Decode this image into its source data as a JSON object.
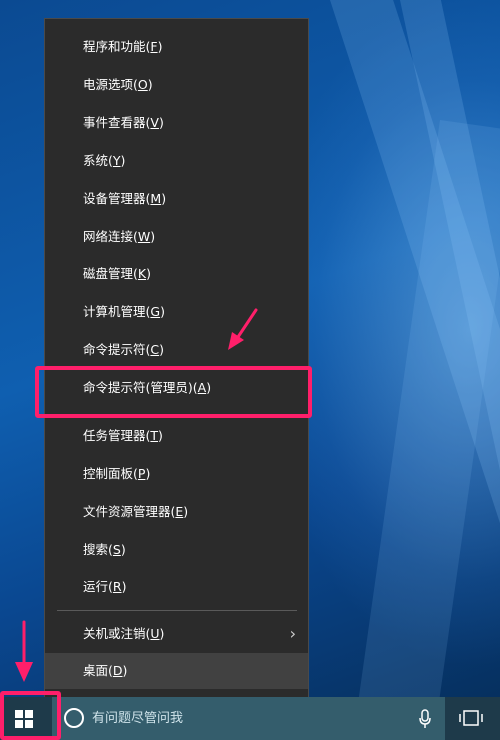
{
  "menu": {
    "items": [
      {
        "label": "程序和功能(",
        "key": "F",
        "tail": ")"
      },
      {
        "label": "电源选项(",
        "key": "O",
        "tail": ")"
      },
      {
        "label": "事件查看器(",
        "key": "V",
        "tail": ")"
      },
      {
        "label": "系统(",
        "key": "Y",
        "tail": ")"
      },
      {
        "label": "设备管理器(",
        "key": "M",
        "tail": ")"
      },
      {
        "label": "网络连接(",
        "key": "W",
        "tail": ")"
      },
      {
        "label": "磁盘管理(",
        "key": "K",
        "tail": ")"
      },
      {
        "label": "计算机管理(",
        "key": "G",
        "tail": ")"
      },
      {
        "label": "命令提示符(",
        "key": "C",
        "tail": ")"
      },
      {
        "label": "命令提示符(管理员)(",
        "key": "A",
        "tail": ")"
      },
      {
        "label": "任务管理器(",
        "key": "T",
        "tail": ")"
      },
      {
        "label": "控制面板(",
        "key": "P",
        "tail": ")"
      },
      {
        "label": "文件资源管理器(",
        "key": "E",
        "tail": ")"
      },
      {
        "label": "搜索(",
        "key": "S",
        "tail": ")"
      },
      {
        "label": "运行(",
        "key": "R",
        "tail": ")"
      },
      {
        "label": "关机或注销(",
        "key": "U",
        "tail": ")"
      },
      {
        "label": "桌面(",
        "key": "D",
        "tail": ")"
      }
    ],
    "submenu_chevron": "›"
  },
  "taskbar": {
    "search_placeholder": "有问题尽管问我"
  },
  "colors": {
    "menu_bg": "#2b2b2b",
    "menu_highlight": "#414141",
    "annotation": "#ff1f6a",
    "taskbar": "#1e3a4a",
    "search_box": "#345d6c"
  },
  "icons": {
    "start": "windows-logo-icon",
    "cortana": "cortana-circle-icon",
    "mic": "microphone-icon",
    "task_view": "task-view-icon",
    "submenu": "chevron-right-icon"
  }
}
